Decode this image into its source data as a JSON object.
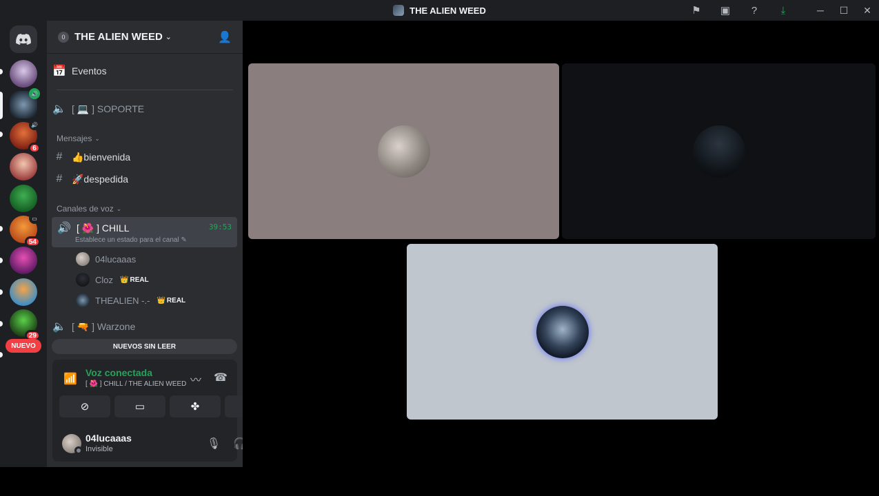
{
  "window": {
    "title": "THE ALIEN WEED",
    "icons": [
      "flag-icon",
      "screen-record-icon",
      "help-icon",
      "download-icon"
    ],
    "controls": [
      "minimize-icon",
      "maximize-icon",
      "close-icon"
    ]
  },
  "guilds": {
    "home_icon": "discord-logo-icon",
    "badges": [
      "6",
      "54",
      "29"
    ],
    "new_label": "NUEVO"
  },
  "server": {
    "name": "THE ALIEN WEED",
    "boost_level": "0",
    "events_label": "Eventos",
    "channels": {
      "soporte": "[ 💻 ] SOPORTE",
      "cat_mensajes": "Mensajes",
      "bienvenida": "👍bienvenida",
      "despedida": "🚀despedida",
      "cat_voz": "Canales de voz",
      "chill_name": "[ 🌺 ] CHILL",
      "chill_timer": "39:53",
      "chill_status": "Establece un estado para el canal",
      "warzone": "[ 🔫 ] Warzone"
    },
    "voice_users": [
      {
        "name": "04lucaaas",
        "tag": ""
      },
      {
        "name": "Cloz",
        "tag": "REAL"
      },
      {
        "name": "THEALIEN -.-",
        "tag": "REAL"
      }
    ],
    "unread_label": "NUEVOS SIN LEER"
  },
  "voice_panel": {
    "title": "Voz conectada",
    "subtitle": "[ 🌺 ] CHILL / THE ALIEN WEED"
  },
  "user": {
    "name": "04lucaaas",
    "status": "Invisible"
  },
  "colors": {
    "accent_green": "#23a559",
    "danger_red": "#f23f43",
    "tile1_bg": "#8a7f7e",
    "tile2_bg": "#101114",
    "tile3_bg": "#c0c6cd"
  }
}
